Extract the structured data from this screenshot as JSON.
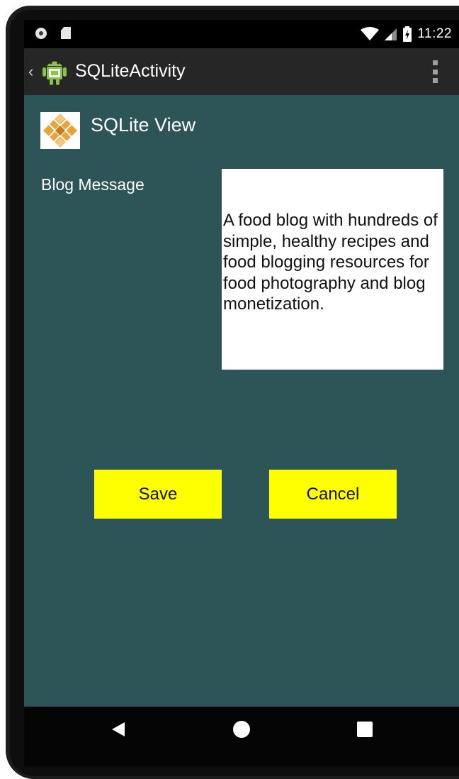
{
  "status_bar": {
    "time": "11:22",
    "icons": [
      "notification-dot-icon",
      "sd-card-icon",
      "wifi-icon",
      "cell-signal-icon",
      "battery-charging-icon"
    ]
  },
  "action_bar": {
    "title": "SQLiteActivity",
    "icons": [
      "back-chevron-icon",
      "android-app-icon",
      "overflow-menu-icon"
    ]
  },
  "header": {
    "title": "SQLite View",
    "logo": "diamond-logo-icon"
  },
  "form": {
    "blog_label": "Blog Message",
    "blog_value": "A food blog with hundreds of simple, healthy recipes and food blogging resources for food photography and blog monetization."
  },
  "buttons": {
    "save": "Save",
    "cancel": "Cancel"
  },
  "nav_bar": {
    "icons": [
      "back-triangle-icon",
      "home-circle-icon",
      "recents-square-icon"
    ]
  },
  "colors": {
    "content_background": "#2d5558",
    "action_bar": "#262626",
    "button": "#ffff00",
    "logo_orange": "#e8a33a"
  }
}
